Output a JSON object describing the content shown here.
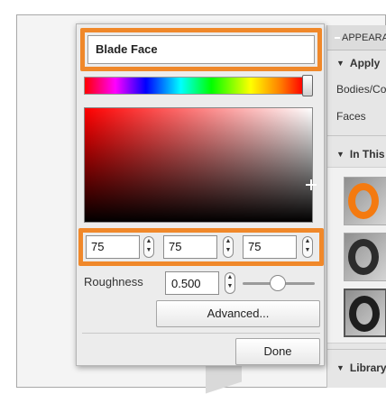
{
  "panel": {
    "header": "APPEARANCE",
    "apply_section": "Apply",
    "bodies_label": "Bodies/Components",
    "faces_label": "Faces",
    "in_this_section": "In This Design",
    "library_section": "Library"
  },
  "popup": {
    "name_value": "Blade Face",
    "rgb": {
      "r": "75",
      "g": "75",
      "b": "75"
    },
    "roughness_label": "Roughness",
    "roughness_value": "0.500",
    "roughness_level": 0.5,
    "advanced_label": "Advanced...",
    "done_label": "Done",
    "highlight_color": "#f0882a"
  }
}
